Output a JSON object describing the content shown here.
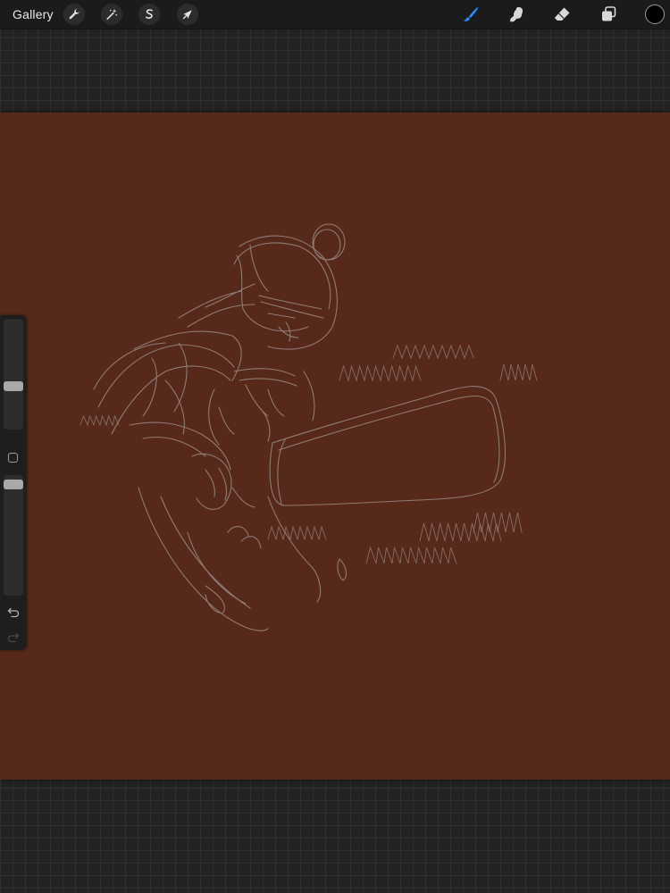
{
  "toolbar": {
    "gallery_label": "Gallery",
    "left_tools": [
      {
        "name": "actions",
        "icon": "wrench-icon"
      },
      {
        "name": "adjustments",
        "icon": "magic-wand-icon"
      },
      {
        "name": "selection",
        "icon": "selection-s-icon"
      },
      {
        "name": "transform",
        "icon": "arrow-cursor-icon"
      }
    ],
    "right_tools": [
      {
        "name": "paint",
        "icon": "brush-icon",
        "active": true
      },
      {
        "name": "smudge",
        "icon": "smudge-finger-icon",
        "active": false
      },
      {
        "name": "erase",
        "icon": "eraser-icon",
        "active": false
      },
      {
        "name": "layers",
        "icon": "layers-icon",
        "active": false
      }
    ],
    "current_color": "#000000"
  },
  "sidebar": {
    "brush_size_level": 0.38,
    "brush_opacity_level": 0.96,
    "modify_icon": "square-icon",
    "undo_icon": "undo-arrow-icon",
    "redo_icon": "redo-arrow-icon"
  },
  "canvas": {
    "background_color": "#56291a",
    "sketch_color": "#9a8a86"
  },
  "colors": {
    "accent": "#1e88ff",
    "workspace_bg": "#232323",
    "toolbar_bg": "#1b1b1b"
  }
}
